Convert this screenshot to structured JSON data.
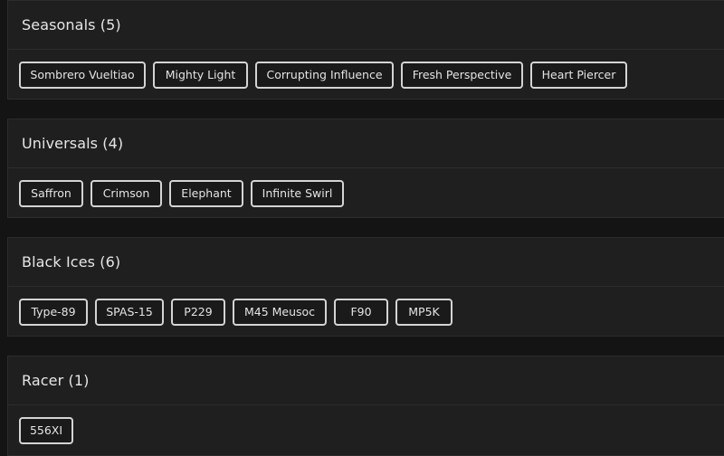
{
  "sections": [
    {
      "title": "Seasonals (5)",
      "items": [
        "Sombrero Vueltiao",
        "Mighty Light",
        "Corrupting Influence",
        "Fresh Perspective",
        "Heart Piercer"
      ]
    },
    {
      "title": "Universals (4)",
      "items": [
        "Saffron",
        "Crimson",
        "Elephant",
        "Infinite Swirl"
      ]
    },
    {
      "title": "Black Ices (6)",
      "items": [
        "Type-89",
        "SPAS-15",
        "P229",
        "M45 Meusoc",
        "F90",
        "MP5K"
      ]
    },
    {
      "title": "Racer (1)",
      "items": [
        "556XI"
      ]
    }
  ]
}
